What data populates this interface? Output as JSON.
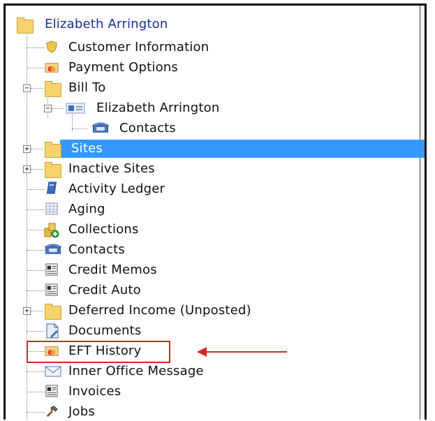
{
  "tree": {
    "root": "Elizabeth Arrington",
    "items": [
      {
        "label": "Customer Information",
        "icon": "shield-icon"
      },
      {
        "label": "Payment Options",
        "icon": "payment-icon"
      },
      {
        "label": "Bill To",
        "icon": "folder-icon"
      },
      {
        "label": "Elizabeth Arrington",
        "icon": "address-card-icon"
      },
      {
        "label": "Contacts",
        "icon": "phone-icon"
      },
      {
        "label": "Sites",
        "icon": "folder-icon"
      },
      {
        "label": "Inactive Sites",
        "icon": "folder-icon"
      },
      {
        "label": "Activity Ledger",
        "icon": "ledger-icon"
      },
      {
        "label": "Aging",
        "icon": "table-icon"
      },
      {
        "label": "Collections",
        "icon": "collections-icon"
      },
      {
        "label": "Contacts",
        "icon": "phone-icon"
      },
      {
        "label": "Credit Memos",
        "icon": "memo-icon"
      },
      {
        "label": "Credit Auto",
        "icon": "memo-icon"
      },
      {
        "label": "Deferred Income (Unposted)",
        "icon": "folder-icon"
      },
      {
        "label": "Documents",
        "icon": "document-icon"
      },
      {
        "label": "EFT History",
        "icon": "payment-icon"
      },
      {
        "label": "Inner Office Message",
        "icon": "envelope-icon"
      },
      {
        "label": "Invoices",
        "icon": "memo-icon"
      },
      {
        "label": "Jobs",
        "icon": "hammer-icon"
      }
    ]
  },
  "colors": {
    "selection": "#3399ff",
    "annotation": "#d62424",
    "root_text": "#1c2f8e"
  }
}
